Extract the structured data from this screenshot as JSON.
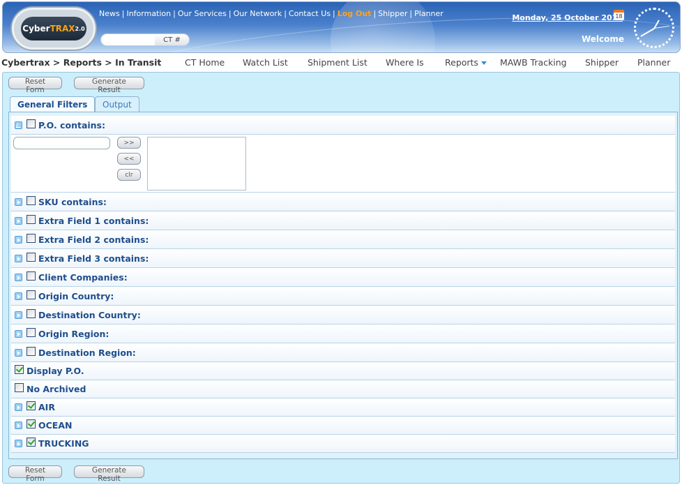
{
  "header": {
    "logo": {
      "text": "Cyber",
      "accent": "TRAX",
      "version": "2.0"
    },
    "links": [
      "News",
      "Information",
      "Our Services",
      "Our Network",
      "Contact Us",
      "Log Out",
      "Shipper",
      "Planner"
    ],
    "ct_search": {
      "value": "",
      "button_label": "CT #"
    },
    "date": "Monday, 25 October 2010",
    "calendar_day": "18",
    "welcome": "Welcome"
  },
  "nav": {
    "breadcrumb": "Cybertrax > Reports > In Transit",
    "items": [
      "CT Home",
      "Watch List",
      "Shipment List",
      "Where Is",
      "Reports",
      "MAWB Tracking",
      "Shipper",
      "Planner"
    ]
  },
  "actions": {
    "reset": "Reset Form",
    "generate": "Generate Result"
  },
  "tabs": [
    {
      "label": "General Filters",
      "active": true
    },
    {
      "label": "Output",
      "active": false
    }
  ],
  "po_filter": {
    "label": "P.O. contains:",
    "checked": false,
    "expanded": true,
    "input_value": "",
    "add": ">>",
    "remove": "<<",
    "clear": "clr"
  },
  "filters": [
    {
      "label": "SKU contains:",
      "checked": false,
      "expandable": true
    },
    {
      "label": "Extra Field 1 contains:",
      "checked": false,
      "expandable": true
    },
    {
      "label": "Extra Field 2 contains:",
      "checked": false,
      "expandable": true
    },
    {
      "label": "Extra Field 3 contains:",
      "checked": false,
      "expandable": true
    },
    {
      "label": "Client Companies:",
      "checked": false,
      "expandable": true
    },
    {
      "label": "Origin Country:",
      "checked": false,
      "expandable": true
    },
    {
      "label": "Destination Country:",
      "checked": false,
      "expandable": true
    },
    {
      "label": "Origin Region:",
      "checked": false,
      "expandable": true
    },
    {
      "label": "Destination Region:",
      "checked": false,
      "expandable": true
    },
    {
      "label": "Display P.O.",
      "checked": true,
      "expandable": false
    },
    {
      "label": "No Archived",
      "checked": false,
      "expandable": false
    },
    {
      "label": "AIR",
      "checked": true,
      "expandable": true
    },
    {
      "label": "OCEAN",
      "checked": true,
      "expandable": true
    },
    {
      "label": "TRUCKING",
      "checked": true,
      "expandable": true
    }
  ],
  "colors": {
    "accent": "#1f4e8c",
    "logout": "#ffa31a",
    "panel": "#cdeefb"
  }
}
